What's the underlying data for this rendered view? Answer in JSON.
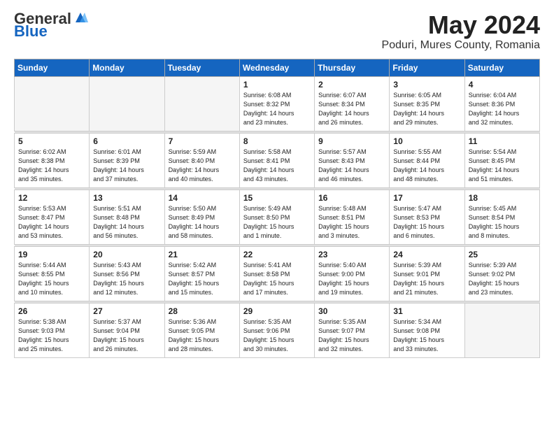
{
  "header": {
    "logo_general": "General",
    "logo_blue": "Blue",
    "title": "May 2024",
    "subtitle": "Poduri, Mures County, Romania"
  },
  "weekdays": [
    "Sunday",
    "Monday",
    "Tuesday",
    "Wednesday",
    "Thursday",
    "Friday",
    "Saturday"
  ],
  "weeks": [
    [
      {
        "num": "",
        "detail": ""
      },
      {
        "num": "",
        "detail": ""
      },
      {
        "num": "",
        "detail": ""
      },
      {
        "num": "1",
        "detail": "Sunrise: 6:08 AM\nSunset: 8:32 PM\nDaylight: 14 hours\nand 23 minutes."
      },
      {
        "num": "2",
        "detail": "Sunrise: 6:07 AM\nSunset: 8:34 PM\nDaylight: 14 hours\nand 26 minutes."
      },
      {
        "num": "3",
        "detail": "Sunrise: 6:05 AM\nSunset: 8:35 PM\nDaylight: 14 hours\nand 29 minutes."
      },
      {
        "num": "4",
        "detail": "Sunrise: 6:04 AM\nSunset: 8:36 PM\nDaylight: 14 hours\nand 32 minutes."
      }
    ],
    [
      {
        "num": "5",
        "detail": "Sunrise: 6:02 AM\nSunset: 8:38 PM\nDaylight: 14 hours\nand 35 minutes."
      },
      {
        "num": "6",
        "detail": "Sunrise: 6:01 AM\nSunset: 8:39 PM\nDaylight: 14 hours\nand 37 minutes."
      },
      {
        "num": "7",
        "detail": "Sunrise: 5:59 AM\nSunset: 8:40 PM\nDaylight: 14 hours\nand 40 minutes."
      },
      {
        "num": "8",
        "detail": "Sunrise: 5:58 AM\nSunset: 8:41 PM\nDaylight: 14 hours\nand 43 minutes."
      },
      {
        "num": "9",
        "detail": "Sunrise: 5:57 AM\nSunset: 8:43 PM\nDaylight: 14 hours\nand 46 minutes."
      },
      {
        "num": "10",
        "detail": "Sunrise: 5:55 AM\nSunset: 8:44 PM\nDaylight: 14 hours\nand 48 minutes."
      },
      {
        "num": "11",
        "detail": "Sunrise: 5:54 AM\nSunset: 8:45 PM\nDaylight: 14 hours\nand 51 minutes."
      }
    ],
    [
      {
        "num": "12",
        "detail": "Sunrise: 5:53 AM\nSunset: 8:47 PM\nDaylight: 14 hours\nand 53 minutes."
      },
      {
        "num": "13",
        "detail": "Sunrise: 5:51 AM\nSunset: 8:48 PM\nDaylight: 14 hours\nand 56 minutes."
      },
      {
        "num": "14",
        "detail": "Sunrise: 5:50 AM\nSunset: 8:49 PM\nDaylight: 14 hours\nand 58 minutes."
      },
      {
        "num": "15",
        "detail": "Sunrise: 5:49 AM\nSunset: 8:50 PM\nDaylight: 15 hours\nand 1 minute."
      },
      {
        "num": "16",
        "detail": "Sunrise: 5:48 AM\nSunset: 8:51 PM\nDaylight: 15 hours\nand 3 minutes."
      },
      {
        "num": "17",
        "detail": "Sunrise: 5:47 AM\nSunset: 8:53 PM\nDaylight: 15 hours\nand 6 minutes."
      },
      {
        "num": "18",
        "detail": "Sunrise: 5:45 AM\nSunset: 8:54 PM\nDaylight: 15 hours\nand 8 minutes."
      }
    ],
    [
      {
        "num": "19",
        "detail": "Sunrise: 5:44 AM\nSunset: 8:55 PM\nDaylight: 15 hours\nand 10 minutes."
      },
      {
        "num": "20",
        "detail": "Sunrise: 5:43 AM\nSunset: 8:56 PM\nDaylight: 15 hours\nand 12 minutes."
      },
      {
        "num": "21",
        "detail": "Sunrise: 5:42 AM\nSunset: 8:57 PM\nDaylight: 15 hours\nand 15 minutes."
      },
      {
        "num": "22",
        "detail": "Sunrise: 5:41 AM\nSunset: 8:58 PM\nDaylight: 15 hours\nand 17 minutes."
      },
      {
        "num": "23",
        "detail": "Sunrise: 5:40 AM\nSunset: 9:00 PM\nDaylight: 15 hours\nand 19 minutes."
      },
      {
        "num": "24",
        "detail": "Sunrise: 5:39 AM\nSunset: 9:01 PM\nDaylight: 15 hours\nand 21 minutes."
      },
      {
        "num": "25",
        "detail": "Sunrise: 5:39 AM\nSunset: 9:02 PM\nDaylight: 15 hours\nand 23 minutes."
      }
    ],
    [
      {
        "num": "26",
        "detail": "Sunrise: 5:38 AM\nSunset: 9:03 PM\nDaylight: 15 hours\nand 25 minutes."
      },
      {
        "num": "27",
        "detail": "Sunrise: 5:37 AM\nSunset: 9:04 PM\nDaylight: 15 hours\nand 26 minutes."
      },
      {
        "num": "28",
        "detail": "Sunrise: 5:36 AM\nSunset: 9:05 PM\nDaylight: 15 hours\nand 28 minutes."
      },
      {
        "num": "29",
        "detail": "Sunrise: 5:35 AM\nSunset: 9:06 PM\nDaylight: 15 hours\nand 30 minutes."
      },
      {
        "num": "30",
        "detail": "Sunrise: 5:35 AM\nSunset: 9:07 PM\nDaylight: 15 hours\nand 32 minutes."
      },
      {
        "num": "31",
        "detail": "Sunrise: 5:34 AM\nSunset: 9:08 PM\nDaylight: 15 hours\nand 33 minutes."
      },
      {
        "num": "",
        "detail": ""
      }
    ]
  ]
}
